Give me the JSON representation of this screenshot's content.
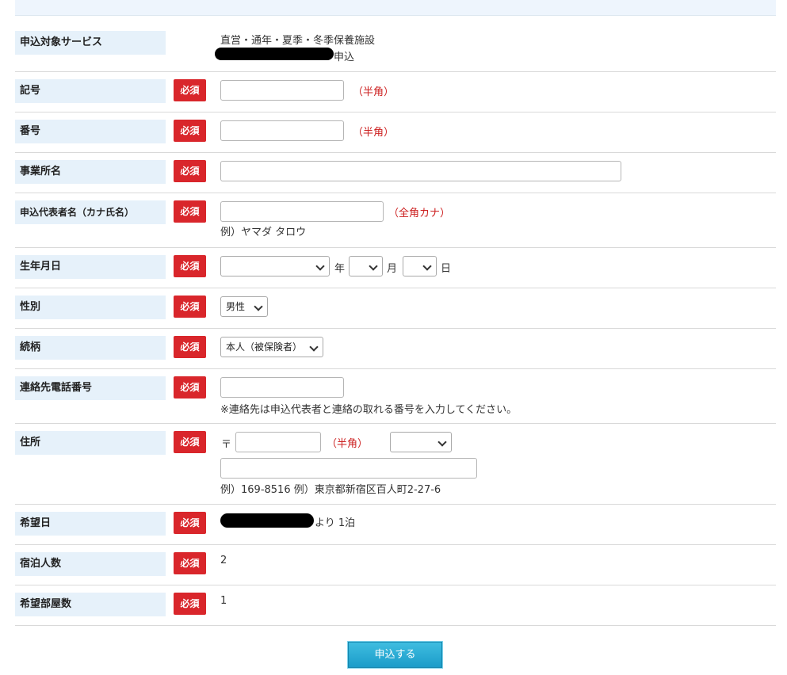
{
  "required_badge": "必須",
  "service": {
    "label": "申込対象サービス",
    "line1": "直営・通年・夏季・冬季保養施設",
    "line2_suffix": "申込"
  },
  "kigou": {
    "label": "記号",
    "note": "（半角）",
    "value": ""
  },
  "bangou": {
    "label": "番号",
    "note": "（半角）",
    "value": ""
  },
  "office": {
    "label": "事業所名",
    "value": ""
  },
  "rep_name": {
    "label": "申込代表者名（カナ氏名）",
    "note": "（全角カナ）",
    "example": "例）ヤマダ タロウ",
    "value": ""
  },
  "birth": {
    "label": "生年月日",
    "year_unit": "年",
    "month_unit": "月",
    "day_unit": "日",
    "year_value": "",
    "month_value": "",
    "day_value": ""
  },
  "gender": {
    "label": "性別",
    "selected": "男性"
  },
  "relation": {
    "label": "続柄",
    "selected": "本人（被保険者）"
  },
  "phone": {
    "label": "連絡先電話番号",
    "note": "※連絡先は申込代表者と連絡の取れる番号を入力してください。",
    "value": ""
  },
  "address": {
    "label": "住所",
    "postal_mark": "〒",
    "note": "（半角）",
    "prefecture_selected": "",
    "example": "例）169-8516 例）東京都新宿区百人町2-27-6"
  },
  "desired_date": {
    "label": "希望日",
    "suffix": "より 1泊"
  },
  "guests": {
    "label": "宿泊人数",
    "value": "2"
  },
  "rooms": {
    "label": "希望部屋数",
    "value": "1"
  },
  "submit_label": "申込する",
  "colors": {
    "required": "#d9262b",
    "label_bg": "#e6f1fa",
    "note_red": "#cc1f1f",
    "submit": "#1b9cc9"
  }
}
